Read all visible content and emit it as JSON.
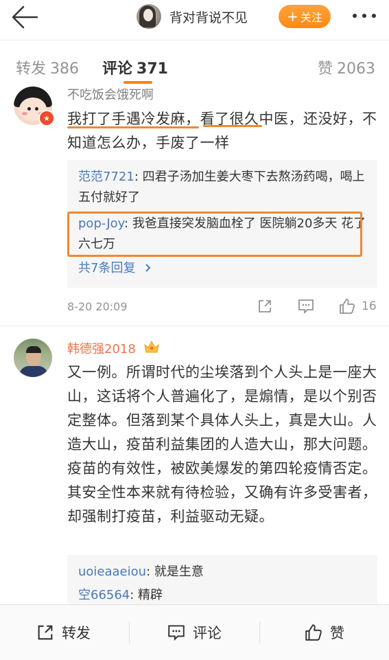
{
  "header": {
    "title": "背对背说不见",
    "follow_label": "关注",
    "follow_plus": "+",
    "back_icon": "arrow-left-icon",
    "more_icon": "more-dots-icon"
  },
  "tabs": {
    "repost": {
      "label": "转发",
      "count": "386"
    },
    "comment": {
      "label": "评论",
      "count": "371"
    },
    "like": {
      "label": "赞",
      "count": "2063"
    }
  },
  "comments": [
    {
      "username": "不吃饭会饿死啊",
      "text": "我打了手遇冷发麻，看了很久中医，还没好，不知道怎么办，手废了一样",
      "replies": [
        {
          "user": "范范7721",
          "text": ": 四君子汤加生姜大枣下去熬汤药喝，喝上五付就好了"
        },
        {
          "user": "pop-Joy",
          "text": ": 我爸直接突发脑血栓了  医院躺20多天  花了六七万"
        }
      ],
      "more_replies": "共7条回复",
      "time": "8-20 20:09",
      "like_count": "16"
    },
    {
      "username": "韩德强2018",
      "text": "又一例。所谓时代的尘埃落到个人头上是一座大山，这话将个人普遍化了，是煽情，是以个别否定整体。但落到某个具体人头上，真是大山。人造大山，疫苗利益集团的人造大山，那大问题。疫苗的有效性，被欧美爆发的第四轮疫情否定。其安全性本来就有待检验，又确有许多受害者，却强制打疫苗，利益驱动无疑。",
      "replies": [
        {
          "user": "uoieaaeiou",
          "text": ": 就是生意"
        },
        {
          "user": "空66564",
          "text": ": 精辟"
        }
      ]
    }
  ],
  "bottom_bar": {
    "repost": "转发",
    "comment": "评论",
    "like": "赞"
  },
  "colors": {
    "accent": "#ff8200",
    "link": "#4a78b8",
    "vip_name": "#eb7350",
    "annotation": "#f08832"
  }
}
